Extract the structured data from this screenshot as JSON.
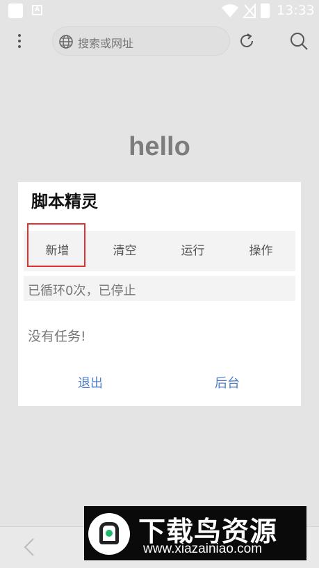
{
  "status_bar": {
    "time": "13:33",
    "notif_letter": "A"
  },
  "toolbar": {
    "url_placeholder": "搜索或网址"
  },
  "page": {
    "hello": "hello"
  },
  "dialog": {
    "title": "脚本精灵",
    "tabs": [
      {
        "label": "新增"
      },
      {
        "label": "清空"
      },
      {
        "label": "运行"
      },
      {
        "label": "操作"
      }
    ],
    "status": "已循环0次，已停止",
    "empty_message": "没有任务!",
    "exit_label": "退出",
    "background_label": "后台"
  },
  "watermark": {
    "title": "下载鸟资源",
    "url": "www.xiazainiao.com"
  },
  "colors": {
    "accent": "#4c7fc6",
    "highlight": "#e03030",
    "watermark_green": "#1fb96a"
  }
}
